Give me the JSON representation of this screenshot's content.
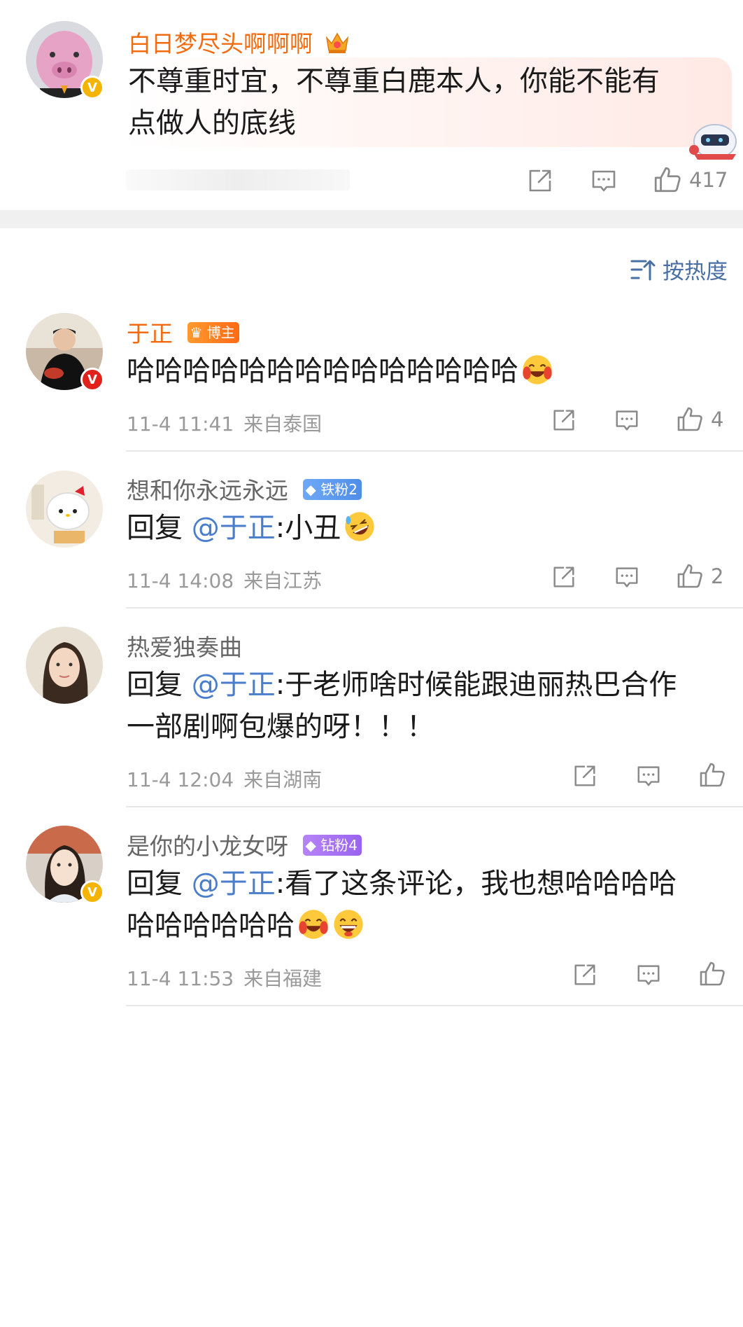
{
  "main_comment": {
    "username": "白日梦尽头啊啊啊",
    "content_line1": "不尊重时宜，不尊重白鹿本人，你能不能有",
    "content_line2": "点做人的底线",
    "likes": "417"
  },
  "sort": {
    "label": "按热度"
  },
  "replies": [
    {
      "username": "于正",
      "badge": "博主",
      "content": "哈哈哈哈哈哈哈哈哈哈哈哈哈哈",
      "date": "11-4 11:41",
      "location": "来自泰国",
      "likes": "4"
    },
    {
      "username": "想和你永远永远",
      "badge": "铁粉2",
      "prefix": "回复",
      "mention": "@于正",
      "content": ":小丑",
      "date": "11-4 14:08",
      "location": "来自江苏",
      "likes": "2"
    },
    {
      "username": "热爱独奏曲",
      "prefix": "回复",
      "mention": "@于正",
      "content_line1": ":于老师啥时候能跟迪丽热巴合作",
      "content_line2": "一部剧啊包爆的呀！！！",
      "date": "11-4 12:04",
      "location": "来自湖南"
    },
    {
      "username": "是你的小龙女呀",
      "badge": "钻粉4",
      "prefix": "回复",
      "mention": "@于正",
      "content_line1": ":看了这条评论，我也想哈哈哈哈",
      "content_line2": "哈哈哈哈哈哈",
      "date": "11-4 11:53",
      "location": "来自福建"
    }
  ]
}
